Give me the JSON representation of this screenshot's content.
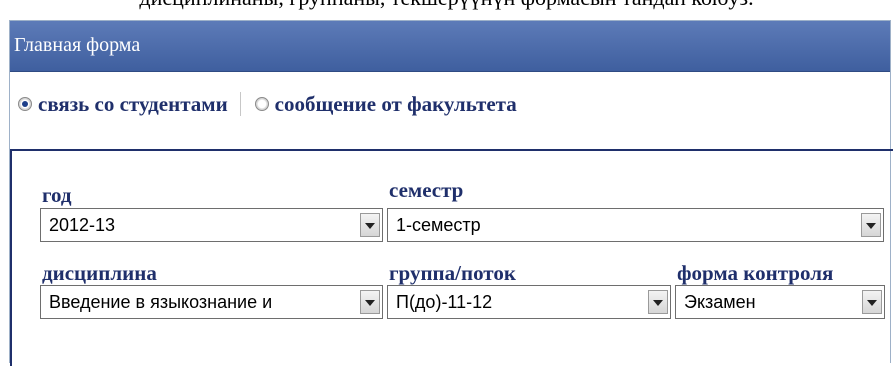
{
  "caption": "дисциплинаны, группаны, текшерүүнүн формасын тандап коюуз.",
  "window": {
    "title": "Главная форма"
  },
  "radio": {
    "options": [
      {
        "label": "связь со студентами",
        "checked": true
      },
      {
        "label": "сообщение от факультета",
        "checked": false
      }
    ]
  },
  "form": {
    "year": {
      "label": "год",
      "value": "2012-13"
    },
    "semester": {
      "label": "семестр",
      "value": "1-семестр"
    },
    "discipline": {
      "label": "дисциплина",
      "value": "Введение в языкознание и"
    },
    "group": {
      "label": "группа/поток",
      "value": "П(до)-11-12"
    },
    "control": {
      "label": "форма контроля",
      "value": "Экзамен"
    }
  }
}
